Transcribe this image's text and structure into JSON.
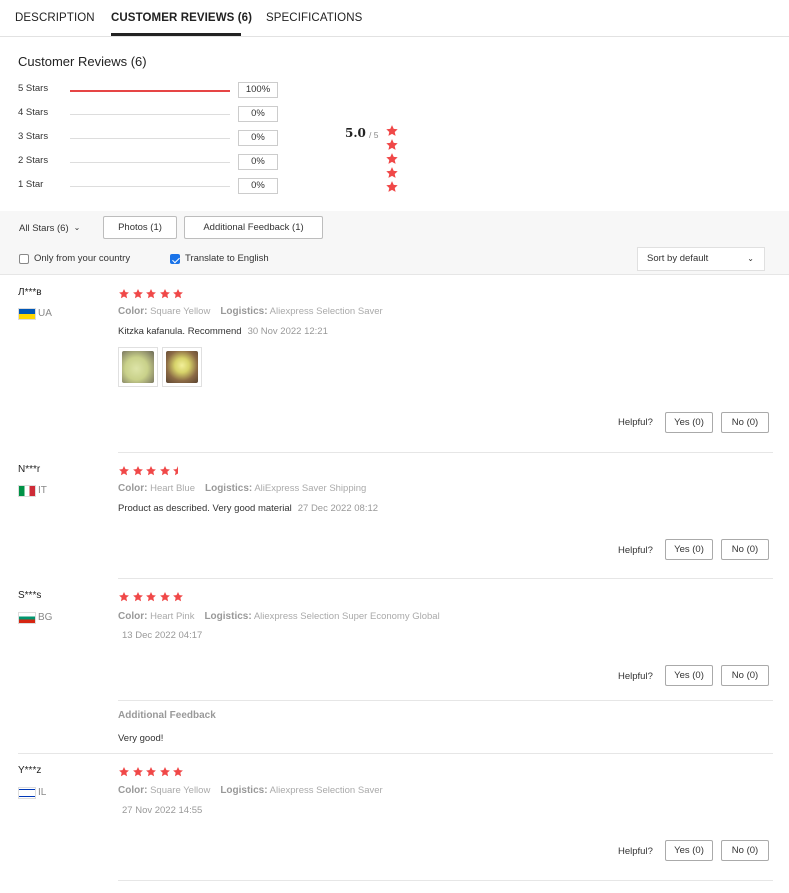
{
  "tabs": [
    {
      "label": "DESCRIPTION",
      "active": false
    },
    {
      "label": "CUSTOMER REVIEWS (6)",
      "active": true
    },
    {
      "label": "SPECIFICATIONS",
      "active": false
    }
  ],
  "summary": {
    "title": "Customer Reviews (6)",
    "distribution": [
      {
        "label": "5 Stars",
        "percent": "100%",
        "fill": 1.0
      },
      {
        "label": "4 Stars",
        "percent": "0%",
        "fill": 0
      },
      {
        "label": "3 Stars",
        "percent": "0%",
        "fill": 0
      },
      {
        "label": "2 Stars",
        "percent": "0%",
        "fill": 0
      },
      {
        "label": "1 Star",
        "percent": "0%",
        "fill": 0
      }
    ],
    "average": "5.0",
    "out_of": "/ 5",
    "average_stars": 5
  },
  "filters": {
    "all_stars": "All Stars (6)",
    "photos": "Photos (1)",
    "additional_feedback": "Additional Feedback (1)",
    "only_country": {
      "label": "Only from your country",
      "checked": false
    },
    "translate": {
      "label": "Translate to English",
      "checked": true
    },
    "sort": "Sort by default"
  },
  "colors": {
    "star": "#f04848",
    "accent_bar": "#e64545",
    "checkbox": "#1a73e8"
  },
  "reviews": [
    {
      "name": "Л***в",
      "country": "UA",
      "stars": 5,
      "color_label": "Color:",
      "color": "Square Yellow",
      "logistics_label": "Logistics:",
      "logistics": "Aliexpress Selection Saver",
      "text": "Kitzka kafanula. Recommend",
      "date": "30 Nov 2022 12:21",
      "photos": 2,
      "helpful": "Helpful?",
      "yes": "Yes (0)",
      "no": "No (0)"
    },
    {
      "name": "N***r",
      "country": "IT",
      "stars": 4.5,
      "color_label": "Color:",
      "color": "Heart Blue",
      "logistics_label": "Logistics:",
      "logistics": "AliExpress Saver Shipping",
      "text": "Product as described. Very good material",
      "date": "27 Dec 2022 08:12",
      "helpful": "Helpful?",
      "yes": "Yes (0)",
      "no": "No (0)"
    },
    {
      "name": "S***s",
      "country": "BG",
      "stars": 5,
      "color_label": "Color:",
      "color": "Heart Pink",
      "logistics_label": "Logistics:",
      "logistics": "Aliexpress Selection Super Economy Global",
      "date": "13 Dec 2022 04:17",
      "helpful": "Helpful?",
      "yes": "Yes (0)",
      "no": "No (0)",
      "additional_title": "Additional Feedback",
      "additional_text": "Very good!"
    },
    {
      "name": "Y***z",
      "country": "IL",
      "stars": 5,
      "color_label": "Color:",
      "color": "Square Yellow",
      "logistics_label": "Logistics:",
      "logistics": "Aliexpress Selection Saver",
      "date": "27 Nov 2022 14:55",
      "helpful": "Helpful?",
      "yes": "Yes (0)",
      "no": "No (0)"
    }
  ]
}
